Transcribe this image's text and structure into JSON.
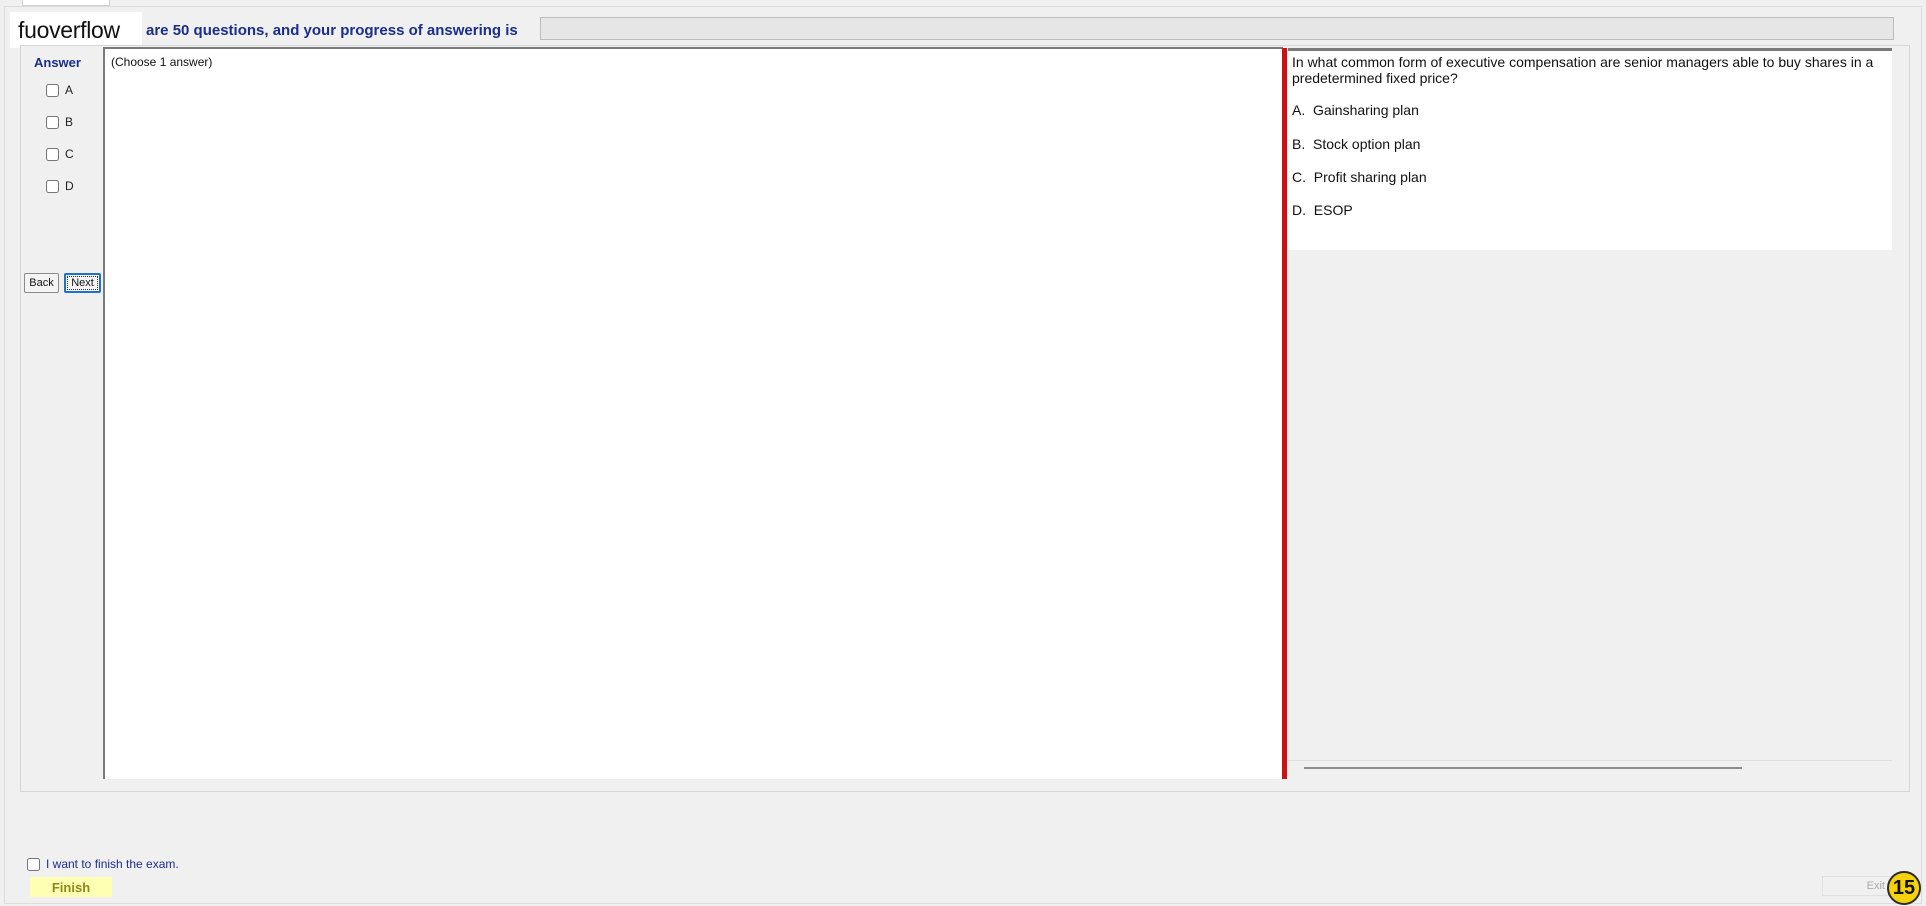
{
  "header": {
    "logo_text": "fuoverflow",
    "progress_text": "are 50 questions, and your progress of answering is",
    "progress_fraction": 0
  },
  "answer_panel": {
    "title": "Answer",
    "options": [
      "A",
      "B",
      "C",
      "D"
    ],
    "back_label": "Back",
    "next_label": "Next"
  },
  "explanation": {
    "instruction": "(Choose 1 answer)"
  },
  "question": {
    "text": "In what common form of executive compensation are senior managers able to buy shares in a predetermined fixed price?",
    "options": [
      "A.  Gainsharing plan",
      "B.  Stock option plan",
      "C.  Profit sharing plan",
      "D.  ESOP"
    ]
  },
  "footer": {
    "finish_check_label": "I want to finish the exam.",
    "finish_label": "Finish",
    "exit_label": "Exit",
    "question_number": "15"
  },
  "colors": {
    "accent_text": "#1a2e8c",
    "splitter": "#cc1111",
    "finish_bg": "#ffffb4",
    "badge": "#f5d20a"
  }
}
